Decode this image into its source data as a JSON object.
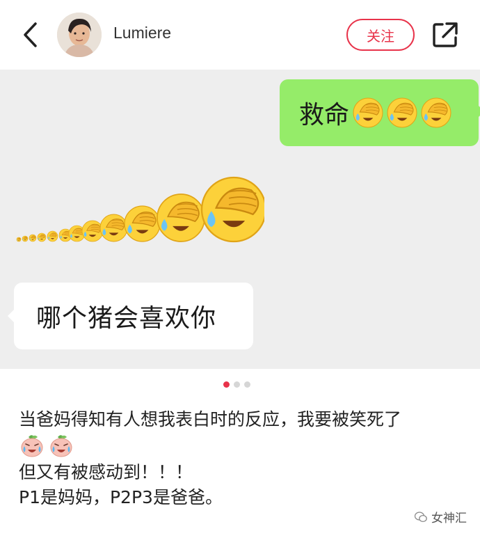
{
  "header": {
    "username": "Lumiere",
    "follow_label": "关注",
    "icons": [
      "chevron-left-icon",
      "avatar",
      "share-icon"
    ]
  },
  "chat": {
    "right_message": "救命",
    "right_emojis": [
      "facepalm-cry-emoji",
      "facepalm-cry-emoji",
      "facepalm-cry-emoji"
    ],
    "trail_emoji": "facepalm-cry-emoji",
    "left_message": "哪个猪会喜欢你"
  },
  "pager": {
    "count": 3,
    "active": 0
  },
  "caption": {
    "line1": "当爸妈得知有人想我表白时的反应，我要被笑死了",
    "peach_emojis": [
      "crying-peach-emoji",
      "crying-peach-emoji"
    ],
    "line3": "但又有被感动到！！！",
    "line4": "P1是妈妈，P2P3是爸爸。"
  },
  "watermark": {
    "text": "女神汇"
  },
  "colors": {
    "accent": "#e8334a",
    "bubble_green": "#95ec69",
    "chat_bg": "#eeeeee"
  }
}
